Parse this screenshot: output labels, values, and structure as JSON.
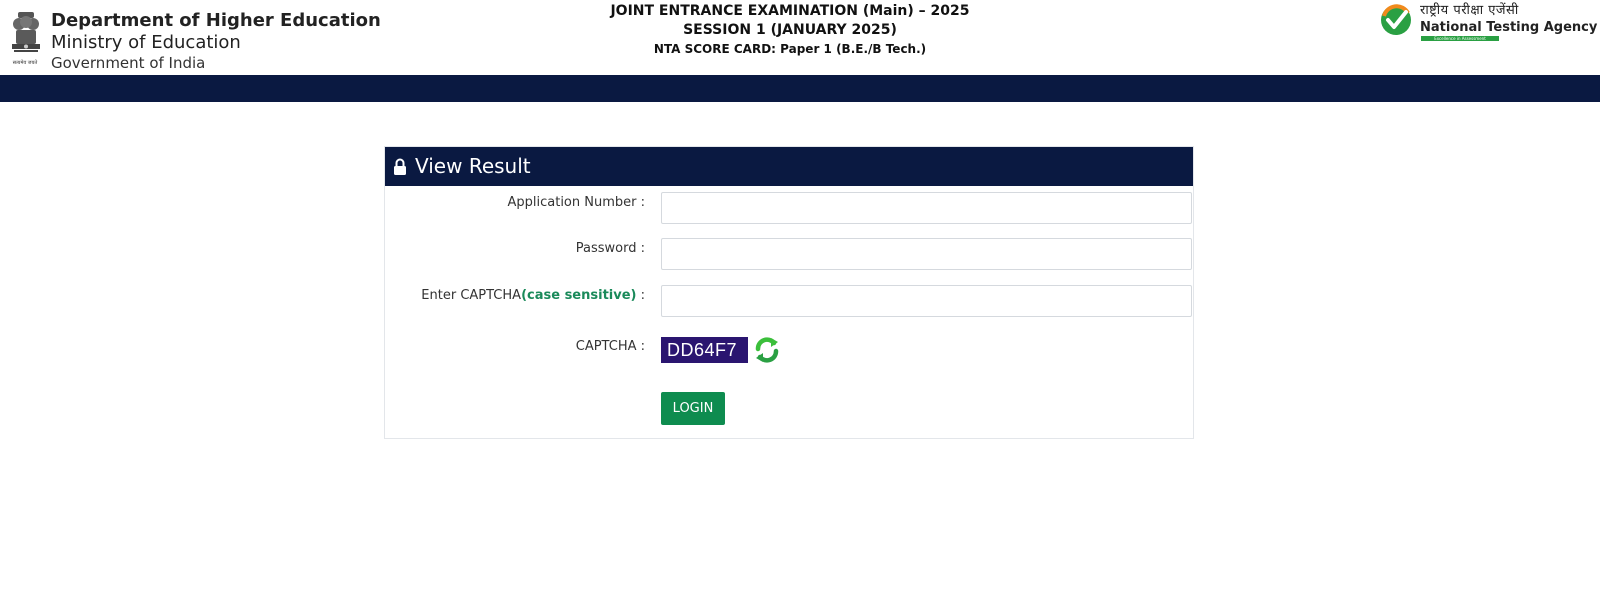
{
  "header": {
    "emblem_caption": "सत्यमेव जयते",
    "dept_line1": "Department of Higher Education",
    "dept_line2": "Ministry of Education",
    "dept_line3": "Government of India",
    "exam_title": "JOINT ENTRANCE EXAMINATION (Main) – 2025",
    "session": "SESSION 1 (JANUARY 2025)",
    "scorecard": "NTA SCORE CARD: Paper 1 (B.E./B Tech.)",
    "nta_hindi": "राष्ट्रीय परीक्षा एजेंसी",
    "nta_english": "National Testing Agency",
    "nta_tagline": "Excellence in Assessment"
  },
  "panel": {
    "title": "View Result",
    "fields": {
      "application_label": "Application Number :",
      "application_value": "",
      "password_label": "Password :",
      "password_value": "",
      "captcha_input_label_prefix": "Enter CAPTCHA",
      "captcha_input_label_hint": "(case sensitive)",
      "captcha_input_label_suffix": " :",
      "captcha_input_value": "",
      "captcha_label": "CAPTCHA :",
      "captcha_text": "DD64F7"
    },
    "login_label": "LOGIN"
  },
  "colors": {
    "navy": "#0a1941",
    "green_button": "#0e8c4f",
    "captcha_bg": "#2a1570",
    "hint_green": "#1a8a5a"
  },
  "icons": {
    "emblem": "national-emblem-icon",
    "nta_logo": "nta-check-logo-icon",
    "lock": "lock-icon",
    "refresh": "refresh-icon"
  }
}
